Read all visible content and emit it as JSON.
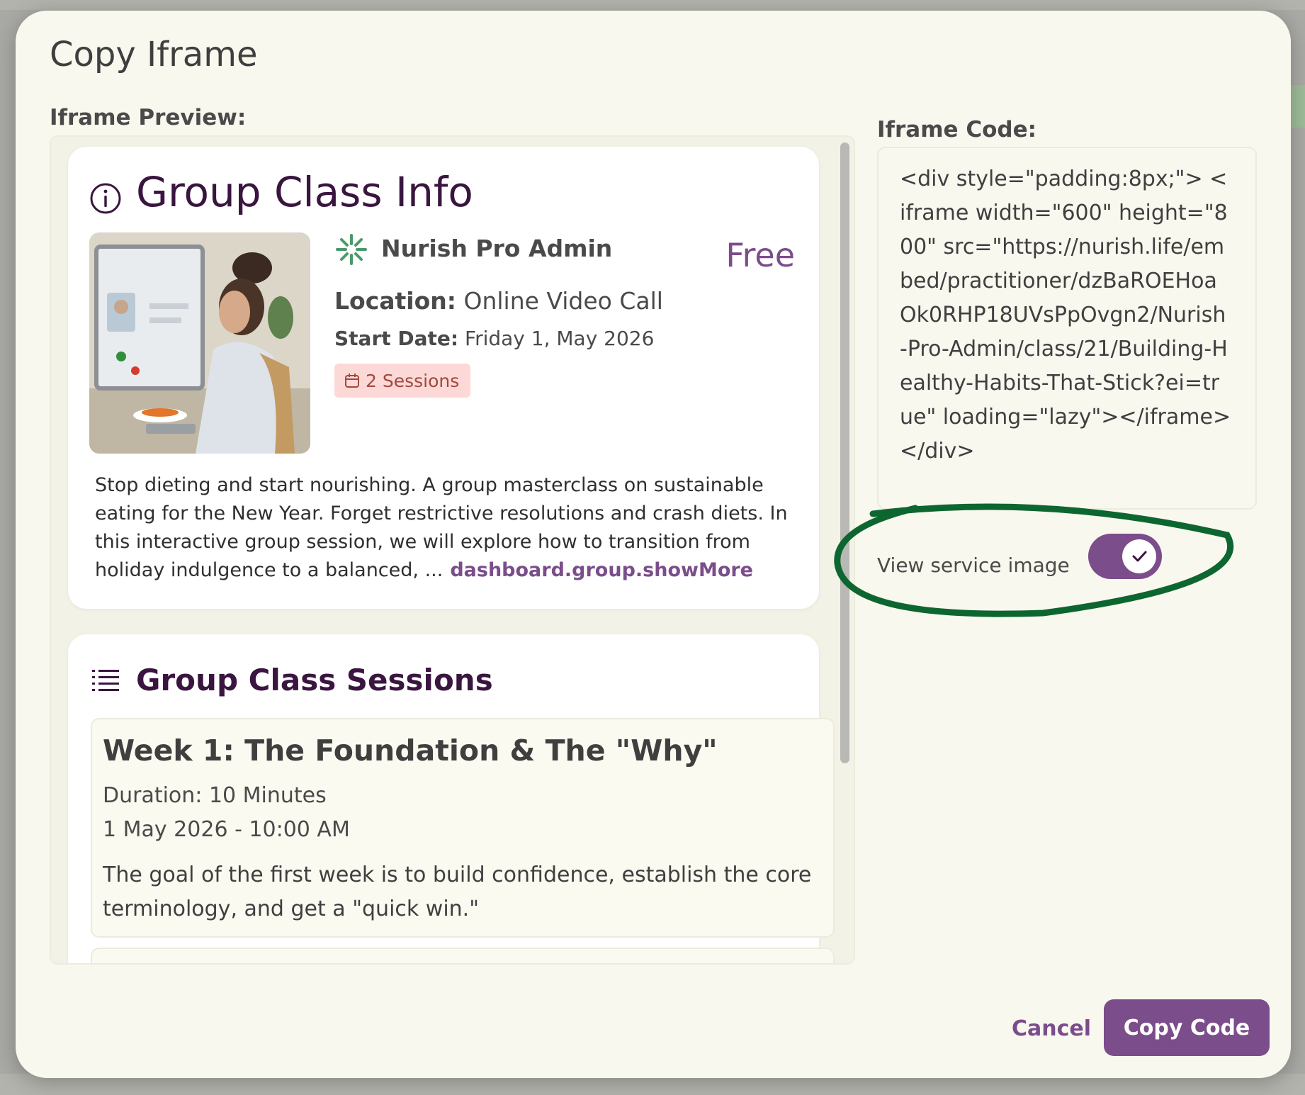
{
  "dialog": {
    "title": "Copy Iframe",
    "preview_label": "Iframe Preview:",
    "code_label": "Iframe Code:",
    "cancel_label": "Cancel",
    "copy_label": "Copy Code"
  },
  "preview": {
    "info_title": "Group Class Info",
    "practitioner": "Nurish Pro Admin",
    "price": "Free",
    "location_label": "Location:",
    "location_value": "Online Video Call",
    "start_date_label": "Start Date:",
    "start_date_value": "Friday 1, May 2026",
    "sessions_badge": "2 Sessions",
    "description": "Stop dieting and start nourishing. A group masterclass on sustainable eating for the New Year. Forget restrictive resolutions and crash diets. In this interactive group session, we will explore how to transition from holiday indulgence to a balanced, ...",
    "show_more": "dashboard.group.showMore",
    "sessions_title": "Group Class Sessions",
    "sessions": [
      {
        "title": "Week 1: The Foundation & The \"Why\"",
        "duration": "Duration: 10 Minutes",
        "datetime": "1 May 2026 - 10:00 AM",
        "description": "The goal of the first week is to build confidence, establish the core terminology, and get a \"quick win.\""
      }
    ]
  },
  "code": {
    "text": "<div style=\"padding:8px;\"> <iframe width=\"600\" height=\"800\" src=\"https://nurish.life/embed/practitioner/dzBaROEHoaOk0RHP18UVsPpOvgn2/Nurish-Pro-Admin/class/21/Building-Healthy-Habits-That-Stick?ei=true\" loading=\"lazy\"></iframe> </div>"
  },
  "toggle": {
    "label": "View service image",
    "checked": true
  },
  "colors": {
    "accent": "#7b4d8b",
    "title": "#3a1540",
    "annotation": "#0d6630",
    "chip_bg": "#fcd9d6",
    "chip_text": "#a1483f"
  },
  "icons": [
    "info-icon",
    "practitioner-logo-icon",
    "calendar-icon",
    "list-icon",
    "check-icon"
  ]
}
